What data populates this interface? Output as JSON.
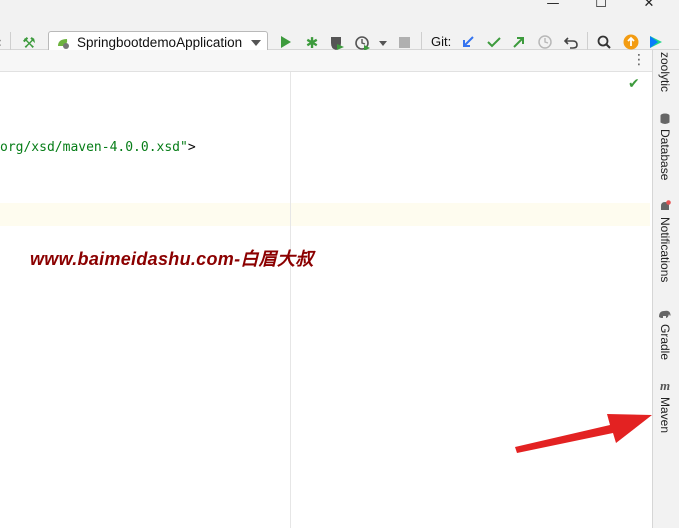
{
  "toolbar": {
    "run_config_label": "SpringbootdemoApplication",
    "git_label": "Git:"
  },
  "editor": {
    "code_text": "org/xsd/maven-4.0.0.xsd",
    "code_quote": "\"",
    "code_close": ">"
  },
  "watermark": "www.baimeidashu.com-白眉大叔",
  "right_tools": [
    {
      "label": "zoolytic",
      "icon": "none"
    },
    {
      "label": "Database",
      "icon": "database-icon"
    },
    {
      "label": "Notifications",
      "icon": "bell-icon"
    },
    {
      "label": "Gradle",
      "icon": "gradle-elephant-icon"
    },
    {
      "label": "Maven",
      "icon": "maven-m-icon"
    }
  ],
  "colors": {
    "watermark": "#8b0000",
    "code_string": "#067d17",
    "arrow": "#e32222",
    "run_green": "#3d9b3d",
    "git_blue": "#3574f0"
  }
}
